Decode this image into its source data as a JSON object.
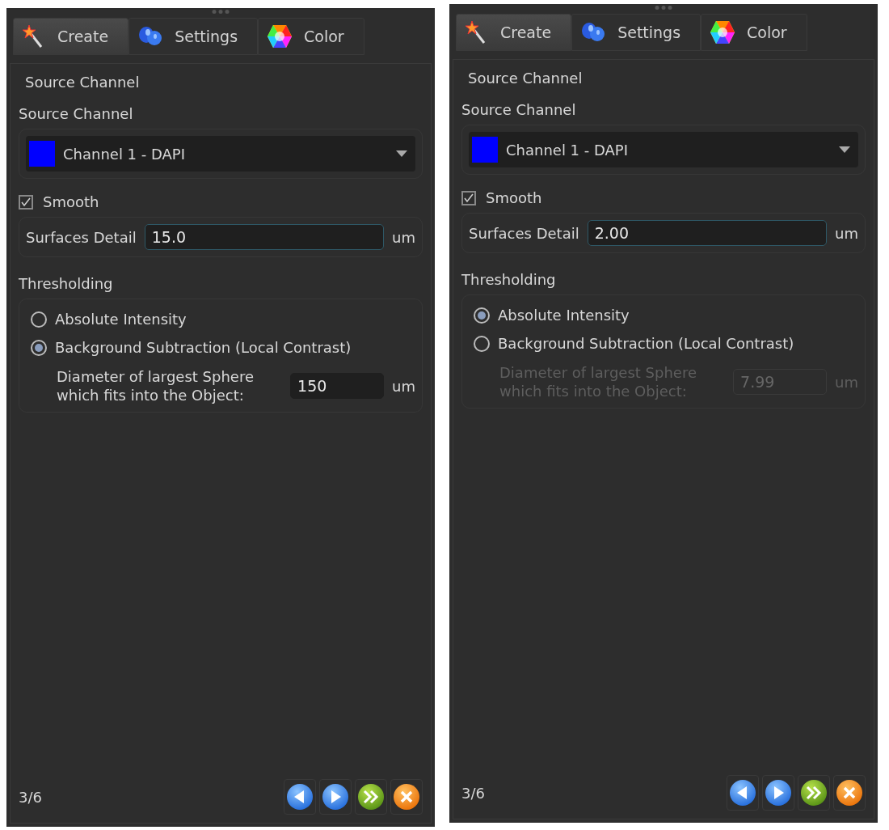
{
  "panels": [
    {
      "tabs": [
        {
          "label": "Create",
          "kind": "wand",
          "selected": true
        },
        {
          "label": "Settings",
          "kind": "blob",
          "selected": false
        },
        {
          "label": "Color",
          "kind": "hexagon",
          "selected": false
        }
      ],
      "section_title": "Source Channel",
      "source_label": "Source Channel",
      "channel": {
        "label": "Channel 1 - DAPI",
        "color": "#0000ff"
      },
      "smooth": {
        "label": "Smooth",
        "checked": true
      },
      "surfaces_detail": {
        "label": "Surfaces Detail",
        "value": "15.0",
        "unit": "um",
        "focused": true
      },
      "thresholding_label": "Thresholding",
      "options": [
        {
          "label": "Absolute Intensity",
          "selected": false
        },
        {
          "label": "Background Subtraction (Local Contrast)",
          "selected": true
        }
      ],
      "diameter": {
        "label": "Diameter of largest Sphere\nwhich fits into the Object:",
        "value": "150",
        "unit": "um",
        "disabled": false
      },
      "page": "3/6",
      "buttons": [
        {
          "kind": "back"
        },
        {
          "kind": "next"
        },
        {
          "kind": "finish"
        },
        {
          "kind": "cancel"
        }
      ]
    },
    {
      "tabs": [
        {
          "label": "Create",
          "kind": "wand",
          "selected": true
        },
        {
          "label": "Settings",
          "kind": "blob",
          "selected": false
        },
        {
          "label": "Color",
          "kind": "hexagon",
          "selected": false
        }
      ],
      "section_title": "Source Channel",
      "source_label": "Source Channel",
      "channel": {
        "label": "Channel 1 - DAPI",
        "color": "#0000ff"
      },
      "smooth": {
        "label": "Smooth",
        "checked": true
      },
      "surfaces_detail": {
        "label": "Surfaces Detail",
        "value": "2.00",
        "unit": "um",
        "focused": true
      },
      "thresholding_label": "Thresholding",
      "options": [
        {
          "label": "Absolute Intensity",
          "selected": true
        },
        {
          "label": "Background Subtraction (Local Contrast)",
          "selected": false
        }
      ],
      "diameter": {
        "label": "Diameter of largest Sphere\nwhich fits into the Object:",
        "value": "7.99",
        "unit": "um",
        "disabled": true
      },
      "page": "3/6",
      "buttons": [
        {
          "kind": "back"
        },
        {
          "kind": "next"
        },
        {
          "kind": "finish"
        },
        {
          "kind": "cancel"
        }
      ]
    }
  ]
}
